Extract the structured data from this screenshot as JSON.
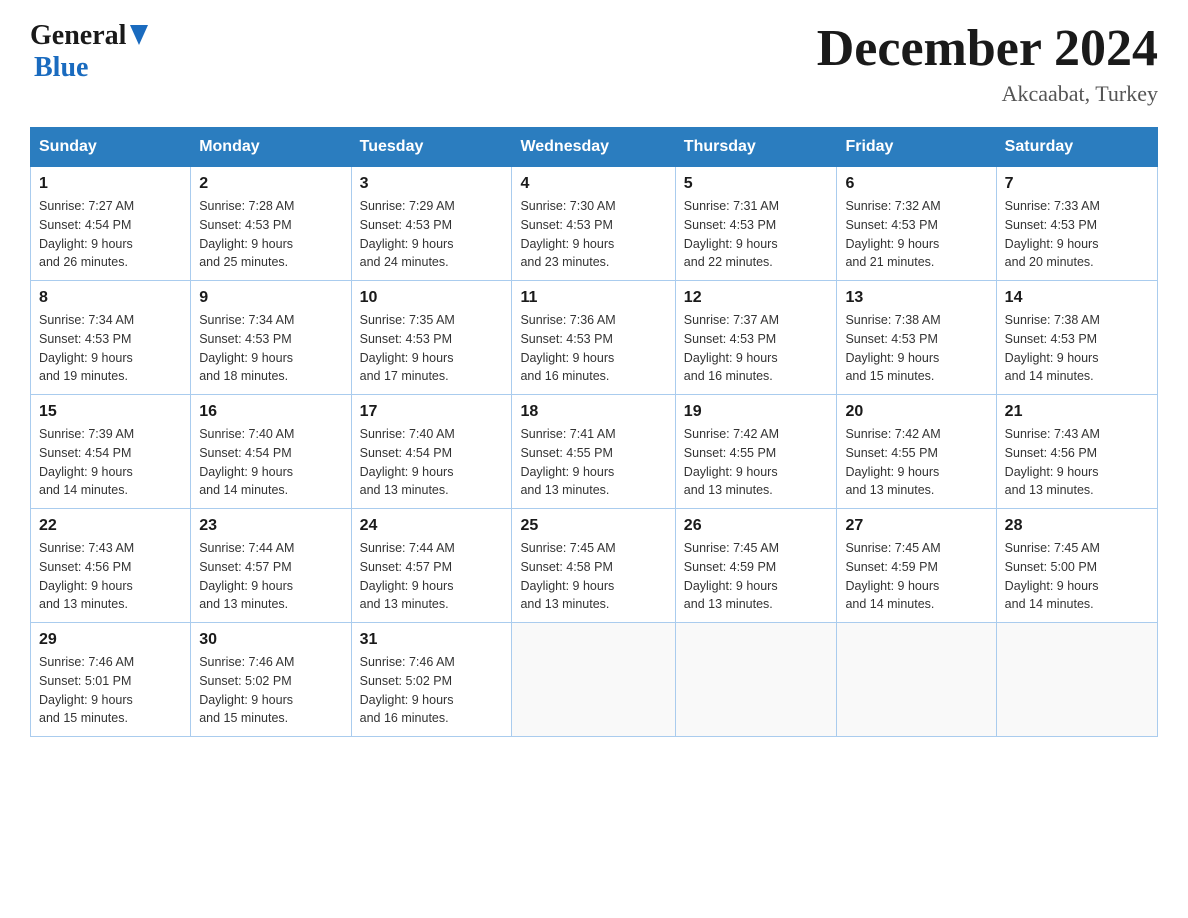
{
  "header": {
    "logo_general": "General",
    "logo_blue": "Blue",
    "month_title": "December 2024",
    "location": "Akcaabat, Turkey"
  },
  "calendar": {
    "days_of_week": [
      "Sunday",
      "Monday",
      "Tuesday",
      "Wednesday",
      "Thursday",
      "Friday",
      "Saturday"
    ],
    "weeks": [
      [
        {
          "day": "1",
          "sunrise": "7:27 AM",
          "sunset": "4:54 PM",
          "daylight": "9 hours and 26 minutes."
        },
        {
          "day": "2",
          "sunrise": "7:28 AM",
          "sunset": "4:53 PM",
          "daylight": "9 hours and 25 minutes."
        },
        {
          "day": "3",
          "sunrise": "7:29 AM",
          "sunset": "4:53 PM",
          "daylight": "9 hours and 24 minutes."
        },
        {
          "day": "4",
          "sunrise": "7:30 AM",
          "sunset": "4:53 PM",
          "daylight": "9 hours and 23 minutes."
        },
        {
          "day": "5",
          "sunrise": "7:31 AM",
          "sunset": "4:53 PM",
          "daylight": "9 hours and 22 minutes."
        },
        {
          "day": "6",
          "sunrise": "7:32 AM",
          "sunset": "4:53 PM",
          "daylight": "9 hours and 21 minutes."
        },
        {
          "day": "7",
          "sunrise": "7:33 AM",
          "sunset": "4:53 PM",
          "daylight": "9 hours and 20 minutes."
        }
      ],
      [
        {
          "day": "8",
          "sunrise": "7:34 AM",
          "sunset": "4:53 PM",
          "daylight": "9 hours and 19 minutes."
        },
        {
          "day": "9",
          "sunrise": "7:34 AM",
          "sunset": "4:53 PM",
          "daylight": "9 hours and 18 minutes."
        },
        {
          "day": "10",
          "sunrise": "7:35 AM",
          "sunset": "4:53 PM",
          "daylight": "9 hours and 17 minutes."
        },
        {
          "day": "11",
          "sunrise": "7:36 AM",
          "sunset": "4:53 PM",
          "daylight": "9 hours and 16 minutes."
        },
        {
          "day": "12",
          "sunrise": "7:37 AM",
          "sunset": "4:53 PM",
          "daylight": "9 hours and 16 minutes."
        },
        {
          "day": "13",
          "sunrise": "7:38 AM",
          "sunset": "4:53 PM",
          "daylight": "9 hours and 15 minutes."
        },
        {
          "day": "14",
          "sunrise": "7:38 AM",
          "sunset": "4:53 PM",
          "daylight": "9 hours and 14 minutes."
        }
      ],
      [
        {
          "day": "15",
          "sunrise": "7:39 AM",
          "sunset": "4:54 PM",
          "daylight": "9 hours and 14 minutes."
        },
        {
          "day": "16",
          "sunrise": "7:40 AM",
          "sunset": "4:54 PM",
          "daylight": "9 hours and 14 minutes."
        },
        {
          "day": "17",
          "sunrise": "7:40 AM",
          "sunset": "4:54 PM",
          "daylight": "9 hours and 13 minutes."
        },
        {
          "day": "18",
          "sunrise": "7:41 AM",
          "sunset": "4:55 PM",
          "daylight": "9 hours and 13 minutes."
        },
        {
          "day": "19",
          "sunrise": "7:42 AM",
          "sunset": "4:55 PM",
          "daylight": "9 hours and 13 minutes."
        },
        {
          "day": "20",
          "sunrise": "7:42 AM",
          "sunset": "4:55 PM",
          "daylight": "9 hours and 13 minutes."
        },
        {
          "day": "21",
          "sunrise": "7:43 AM",
          "sunset": "4:56 PM",
          "daylight": "9 hours and 13 minutes."
        }
      ],
      [
        {
          "day": "22",
          "sunrise": "7:43 AM",
          "sunset": "4:56 PM",
          "daylight": "9 hours and 13 minutes."
        },
        {
          "day": "23",
          "sunrise": "7:44 AM",
          "sunset": "4:57 PM",
          "daylight": "9 hours and 13 minutes."
        },
        {
          "day": "24",
          "sunrise": "7:44 AM",
          "sunset": "4:57 PM",
          "daylight": "9 hours and 13 minutes."
        },
        {
          "day": "25",
          "sunrise": "7:45 AM",
          "sunset": "4:58 PM",
          "daylight": "9 hours and 13 minutes."
        },
        {
          "day": "26",
          "sunrise": "7:45 AM",
          "sunset": "4:59 PM",
          "daylight": "9 hours and 13 minutes."
        },
        {
          "day": "27",
          "sunrise": "7:45 AM",
          "sunset": "4:59 PM",
          "daylight": "9 hours and 14 minutes."
        },
        {
          "day": "28",
          "sunrise": "7:45 AM",
          "sunset": "5:00 PM",
          "daylight": "9 hours and 14 minutes."
        }
      ],
      [
        {
          "day": "29",
          "sunrise": "7:46 AM",
          "sunset": "5:01 PM",
          "daylight": "9 hours and 15 minutes."
        },
        {
          "day": "30",
          "sunrise": "7:46 AM",
          "sunset": "5:02 PM",
          "daylight": "9 hours and 15 minutes."
        },
        {
          "day": "31",
          "sunrise": "7:46 AM",
          "sunset": "5:02 PM",
          "daylight": "9 hours and 16 minutes."
        },
        null,
        null,
        null,
        null
      ]
    ],
    "sunrise_label": "Sunrise:",
    "sunset_label": "Sunset:",
    "daylight_label": "Daylight:"
  }
}
